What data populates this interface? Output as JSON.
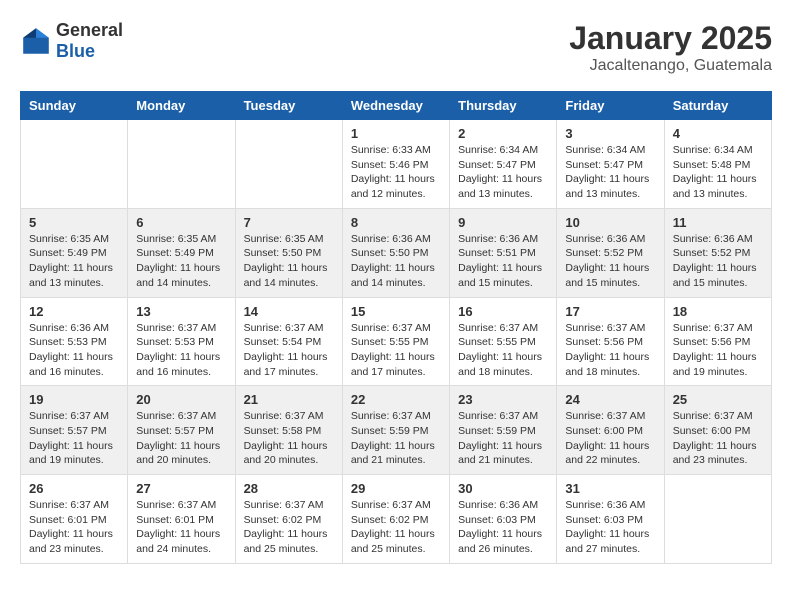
{
  "header": {
    "logo": {
      "general": "General",
      "blue": "Blue"
    },
    "title": "January 2025",
    "subtitle": "Jacaltenango, Guatemala"
  },
  "calendar": {
    "days_of_week": [
      "Sunday",
      "Monday",
      "Tuesday",
      "Wednesday",
      "Thursday",
      "Friday",
      "Saturday"
    ],
    "weeks": [
      [
        {
          "day": "",
          "info": ""
        },
        {
          "day": "",
          "info": ""
        },
        {
          "day": "",
          "info": ""
        },
        {
          "day": "1",
          "info": "Sunrise: 6:33 AM\nSunset: 5:46 PM\nDaylight: 11 hours and 12 minutes."
        },
        {
          "day": "2",
          "info": "Sunrise: 6:34 AM\nSunset: 5:47 PM\nDaylight: 11 hours and 13 minutes."
        },
        {
          "day": "3",
          "info": "Sunrise: 6:34 AM\nSunset: 5:47 PM\nDaylight: 11 hours and 13 minutes."
        },
        {
          "day": "4",
          "info": "Sunrise: 6:34 AM\nSunset: 5:48 PM\nDaylight: 11 hours and 13 minutes."
        }
      ],
      [
        {
          "day": "5",
          "info": "Sunrise: 6:35 AM\nSunset: 5:49 PM\nDaylight: 11 hours and 13 minutes."
        },
        {
          "day": "6",
          "info": "Sunrise: 6:35 AM\nSunset: 5:49 PM\nDaylight: 11 hours and 14 minutes."
        },
        {
          "day": "7",
          "info": "Sunrise: 6:35 AM\nSunset: 5:50 PM\nDaylight: 11 hours and 14 minutes."
        },
        {
          "day": "8",
          "info": "Sunrise: 6:36 AM\nSunset: 5:50 PM\nDaylight: 11 hours and 14 minutes."
        },
        {
          "day": "9",
          "info": "Sunrise: 6:36 AM\nSunset: 5:51 PM\nDaylight: 11 hours and 15 minutes."
        },
        {
          "day": "10",
          "info": "Sunrise: 6:36 AM\nSunset: 5:52 PM\nDaylight: 11 hours and 15 minutes."
        },
        {
          "day": "11",
          "info": "Sunrise: 6:36 AM\nSunset: 5:52 PM\nDaylight: 11 hours and 15 minutes."
        }
      ],
      [
        {
          "day": "12",
          "info": "Sunrise: 6:36 AM\nSunset: 5:53 PM\nDaylight: 11 hours and 16 minutes."
        },
        {
          "day": "13",
          "info": "Sunrise: 6:37 AM\nSunset: 5:53 PM\nDaylight: 11 hours and 16 minutes."
        },
        {
          "day": "14",
          "info": "Sunrise: 6:37 AM\nSunset: 5:54 PM\nDaylight: 11 hours and 17 minutes."
        },
        {
          "day": "15",
          "info": "Sunrise: 6:37 AM\nSunset: 5:55 PM\nDaylight: 11 hours and 17 minutes."
        },
        {
          "day": "16",
          "info": "Sunrise: 6:37 AM\nSunset: 5:55 PM\nDaylight: 11 hours and 18 minutes."
        },
        {
          "day": "17",
          "info": "Sunrise: 6:37 AM\nSunset: 5:56 PM\nDaylight: 11 hours and 18 minutes."
        },
        {
          "day": "18",
          "info": "Sunrise: 6:37 AM\nSunset: 5:56 PM\nDaylight: 11 hours and 19 minutes."
        }
      ],
      [
        {
          "day": "19",
          "info": "Sunrise: 6:37 AM\nSunset: 5:57 PM\nDaylight: 11 hours and 19 minutes."
        },
        {
          "day": "20",
          "info": "Sunrise: 6:37 AM\nSunset: 5:57 PM\nDaylight: 11 hours and 20 minutes."
        },
        {
          "day": "21",
          "info": "Sunrise: 6:37 AM\nSunset: 5:58 PM\nDaylight: 11 hours and 20 minutes."
        },
        {
          "day": "22",
          "info": "Sunrise: 6:37 AM\nSunset: 5:59 PM\nDaylight: 11 hours and 21 minutes."
        },
        {
          "day": "23",
          "info": "Sunrise: 6:37 AM\nSunset: 5:59 PM\nDaylight: 11 hours and 21 minutes."
        },
        {
          "day": "24",
          "info": "Sunrise: 6:37 AM\nSunset: 6:00 PM\nDaylight: 11 hours and 22 minutes."
        },
        {
          "day": "25",
          "info": "Sunrise: 6:37 AM\nSunset: 6:00 PM\nDaylight: 11 hours and 23 minutes."
        }
      ],
      [
        {
          "day": "26",
          "info": "Sunrise: 6:37 AM\nSunset: 6:01 PM\nDaylight: 11 hours and 23 minutes."
        },
        {
          "day": "27",
          "info": "Sunrise: 6:37 AM\nSunset: 6:01 PM\nDaylight: 11 hours and 24 minutes."
        },
        {
          "day": "28",
          "info": "Sunrise: 6:37 AM\nSunset: 6:02 PM\nDaylight: 11 hours and 25 minutes."
        },
        {
          "day": "29",
          "info": "Sunrise: 6:37 AM\nSunset: 6:02 PM\nDaylight: 11 hours and 25 minutes."
        },
        {
          "day": "30",
          "info": "Sunrise: 6:36 AM\nSunset: 6:03 PM\nDaylight: 11 hours and 26 minutes."
        },
        {
          "day": "31",
          "info": "Sunrise: 6:36 AM\nSunset: 6:03 PM\nDaylight: 11 hours and 27 minutes."
        },
        {
          "day": "",
          "info": ""
        }
      ]
    ]
  }
}
